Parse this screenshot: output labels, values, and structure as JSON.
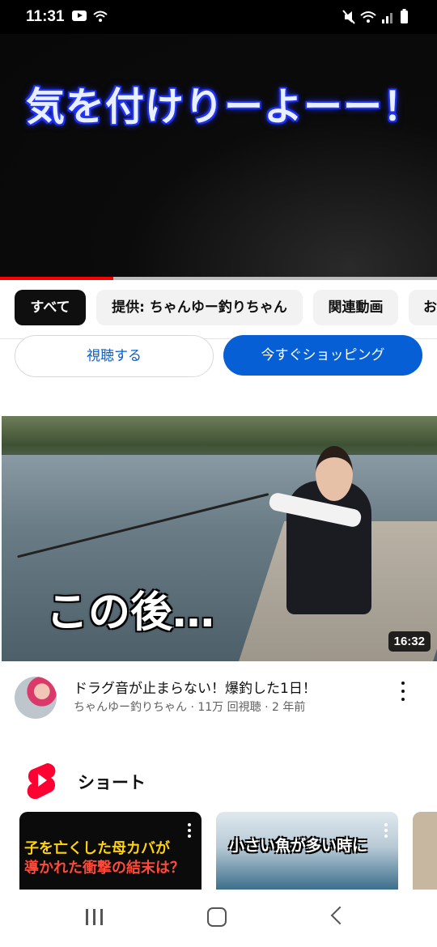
{
  "status_bar": {
    "time": "11:31",
    "icons": [
      "youtube-icon",
      "wifi-call-icon",
      "mute-icon",
      "wifi-icon",
      "signal-icon",
      "battery-icon"
    ]
  },
  "player": {
    "caption": "気を付けりーよーー！",
    "progress_fraction": 0.26,
    "progress_color": "#ff0000"
  },
  "chips": [
    "すべて",
    "提供: ちゃんゆー釣りちゃん",
    "関連動画",
    "お"
  ],
  "shopping": {
    "watch_label": "視聴する",
    "shop_now_label": "今すぐショッピング"
  },
  "video": {
    "overlay_text": "この後…",
    "duration": "16:32",
    "title": "ドラグ音が止まらない！爆釣した1日！",
    "meta": "ちゃんゆー釣りちゃん · 11万 回視聴 · 2 年前"
  },
  "shorts": {
    "section_title": "ショート",
    "items": [
      {
        "line1": "子を亡くした母カバが",
        "line2": "導かれた衝撃の結末は？"
      },
      {
        "line1": "小さい魚が多い時に"
      }
    ]
  },
  "colors": {
    "accent_blue": "#065fd4",
    "shorts_red": "#ff0033"
  }
}
